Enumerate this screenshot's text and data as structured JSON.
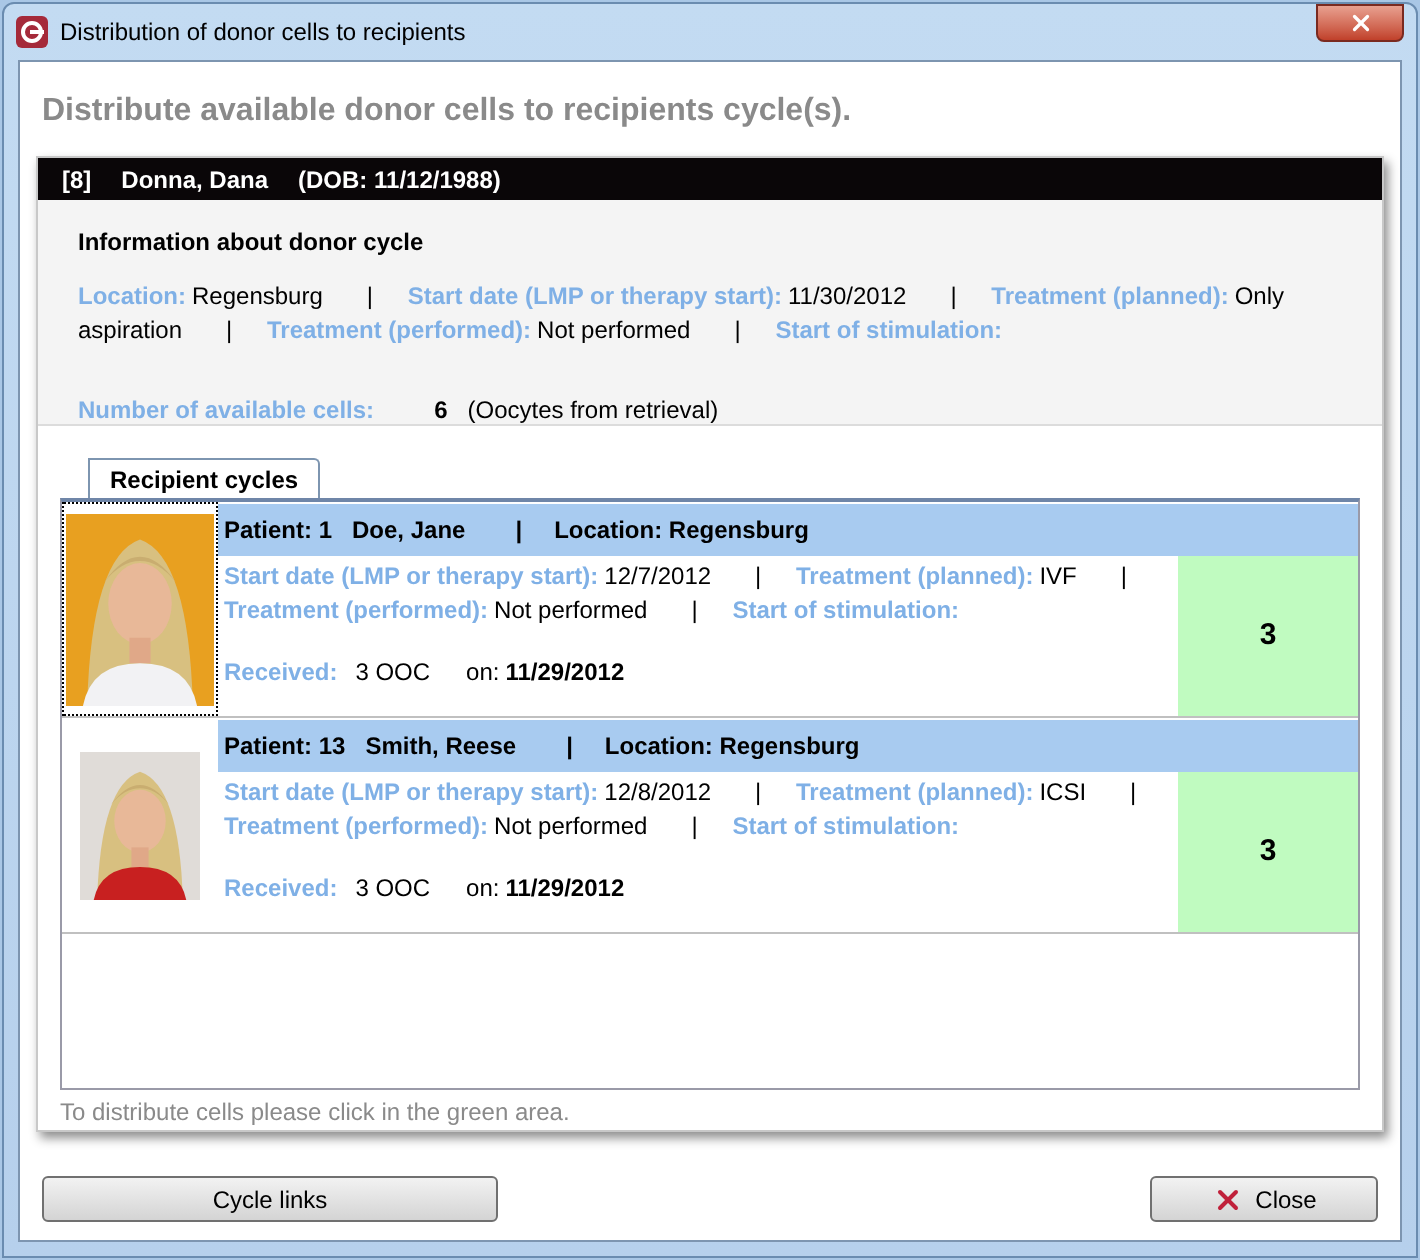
{
  "window": {
    "title": "Distribution of donor cells to recipients"
  },
  "heading": "Distribute available donor cells to recipients cycle(s).",
  "donor": {
    "number": "[8]",
    "name": "Donna, Dana",
    "dob": "(DOB: 11/12/1988)",
    "info_title": "Information about donor cycle",
    "fields": [
      {
        "label": "Location:",
        "value": "Regensburg",
        "sep": "|"
      },
      {
        "label": "Start date (LMP or therapy start):",
        "value": "11/30/2012",
        "sep": "|"
      },
      {
        "label": "Treatment (planned):",
        "value": "Only aspiration",
        "sep": "|"
      },
      {
        "label": "Treatment (performed):",
        "value": "Not performed",
        "sep": "|"
      },
      {
        "label": "Start of stimulation:"
      }
    ],
    "available_label": "Number of available cells:",
    "available_count": "6",
    "available_note": "(Oocytes from retrieval)"
  },
  "tab": {
    "label": "Recipient cycles",
    "selected": true
  },
  "recipients": [
    {
      "patient": "Patient: 1",
      "name": "Doe, Jane",
      "sep": "|",
      "location": "Location: Regensburg",
      "selected": true,
      "fields": [
        {
          "label": "Start date (LMP or therapy start):",
          "value": "12/7/2012",
          "sep": "|"
        },
        {
          "label": "Treatment (planned):",
          "value": "IVF",
          "sep": "|"
        },
        {
          "label": "Treatment (performed):",
          "value": "Not performed",
          "sep": "|"
        },
        {
          "label": "Start of stimulation:"
        }
      ],
      "received_label": "Received:",
      "received_value": "3 OOC",
      "on_label": "on:",
      "on_date": "11/29/2012",
      "count": "3"
    },
    {
      "patient": "Patient: 13",
      "name": "Smith, Reese",
      "sep": "|",
      "location": "Location: Regensburg",
      "selected": false,
      "fields": [
        {
          "label": "Start date (LMP or therapy start):",
          "value": "12/8/2012",
          "sep": "|"
        },
        {
          "label": "Treatment (planned):",
          "value": "ICSI",
          "sep": "|"
        },
        {
          "label": "Treatment (performed):",
          "value": "Not performed",
          "sep": "|"
        },
        {
          "label": "Start of stimulation:"
        }
      ],
      "received_label": "Received:",
      "received_value": "3 OOC",
      "on_label": "on:",
      "on_date": "11/29/2012",
      "count": "3"
    }
  ],
  "hint": "To distribute cells please click in the green area.",
  "buttons": [
    {
      "label": "Cycle links",
      "kind": "plain"
    },
    {
      "label": "Close",
      "kind": "close"
    }
  ]
}
